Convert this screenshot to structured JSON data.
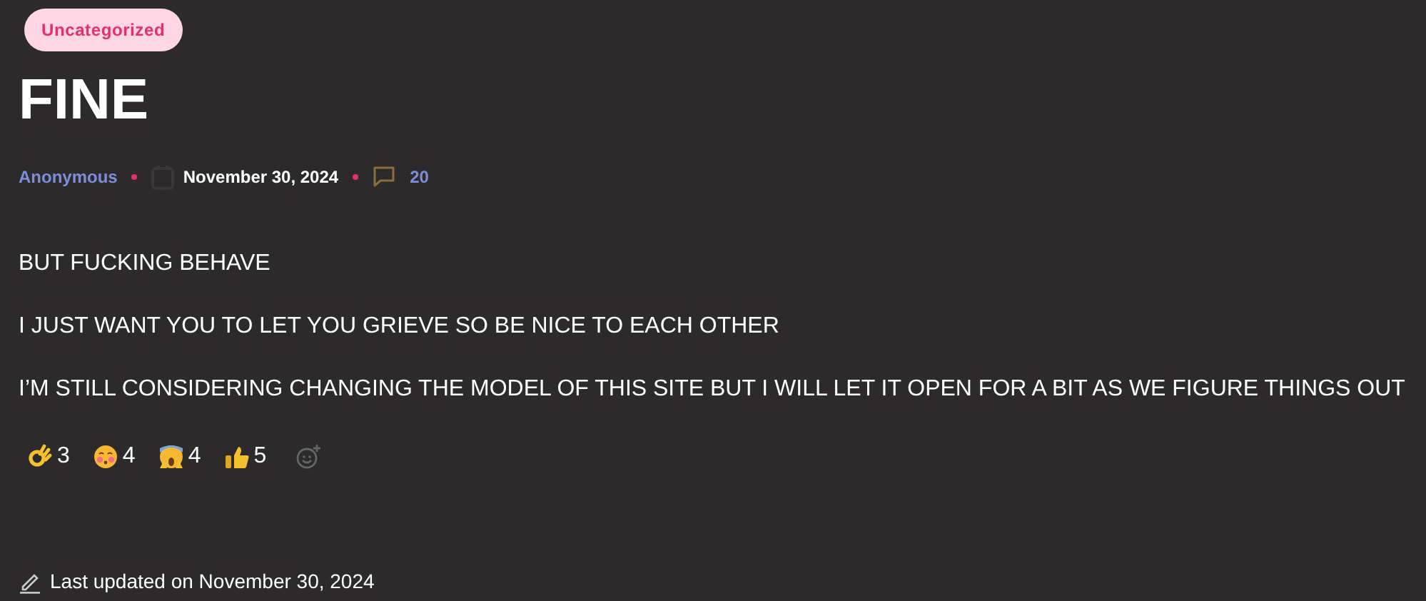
{
  "category": "Uncategorized",
  "title": "FINE",
  "meta": {
    "author": "Anonymous",
    "date": "November 30, 2024",
    "comments": "20"
  },
  "paragraphs": [
    "BUT FUCKING BEHAVE",
    "I JUST WANT YOU TO LET YOU GRIEVE SO BE NICE TO EACH OTHER",
    "I’M STILL CONSIDERING CHANGING THE MODEL OF THIS SITE BUT I WILL LET IT OPEN FOR A BIT AS WE FIGURE THINGS OUT"
  ],
  "reactions": [
    {
      "kind": "ok-hand",
      "count": "3"
    },
    {
      "kind": "kiss",
      "count": "4"
    },
    {
      "kind": "scream",
      "count": "4"
    },
    {
      "kind": "thumbs-up",
      "count": "5"
    }
  ],
  "updated": "Last updated on November 30, 2024"
}
